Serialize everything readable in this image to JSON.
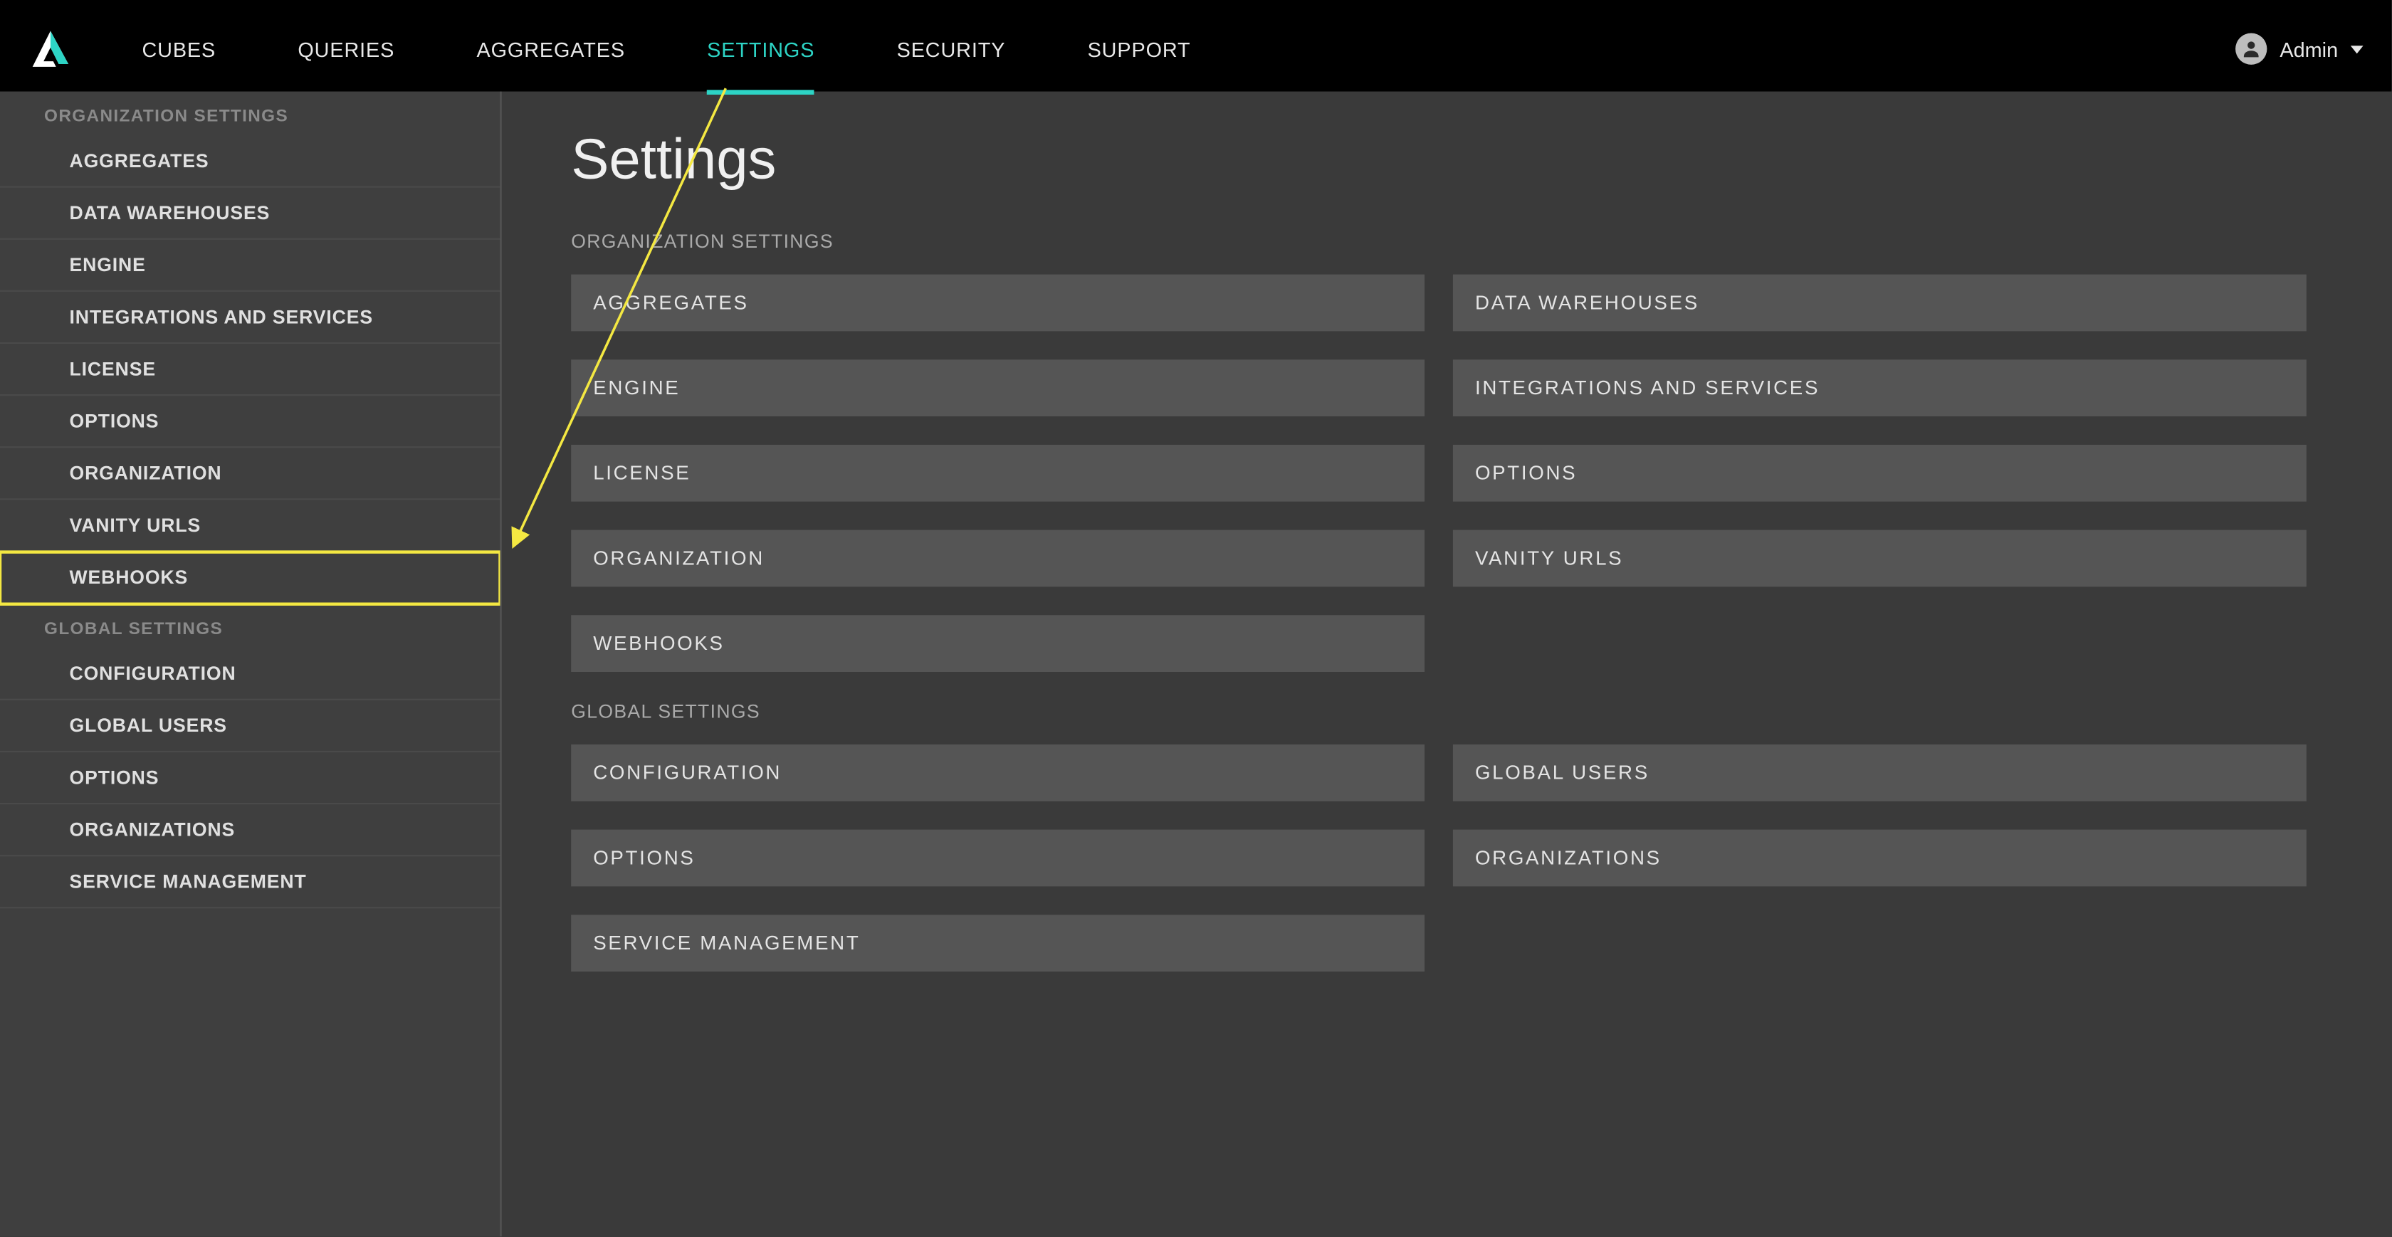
{
  "nav": {
    "items": [
      {
        "label": "CUBES",
        "active": false
      },
      {
        "label": "QUERIES",
        "active": false
      },
      {
        "label": "AGGREGATES",
        "active": false
      },
      {
        "label": "SETTINGS",
        "active": true
      },
      {
        "label": "SECURITY",
        "active": false
      },
      {
        "label": "SUPPORT",
        "active": false
      }
    ]
  },
  "user": {
    "name": "Admin"
  },
  "sidebar": {
    "sections": [
      {
        "title": "ORGANIZATION SETTINGS",
        "items": [
          {
            "label": "AGGREGATES"
          },
          {
            "label": "DATA WAREHOUSES"
          },
          {
            "label": "ENGINE"
          },
          {
            "label": "INTEGRATIONS AND SERVICES"
          },
          {
            "label": "LICENSE"
          },
          {
            "label": "OPTIONS"
          },
          {
            "label": "ORGANIZATION"
          },
          {
            "label": "VANITY URLS"
          },
          {
            "label": "WEBHOOKS",
            "highlighted": true
          }
        ]
      },
      {
        "title": "GLOBAL SETTINGS",
        "items": [
          {
            "label": "CONFIGURATION"
          },
          {
            "label": "GLOBAL USERS"
          },
          {
            "label": "OPTIONS"
          },
          {
            "label": "ORGANIZATIONS"
          },
          {
            "label": "SERVICE MANAGEMENT"
          }
        ]
      }
    ]
  },
  "page": {
    "title": "Settings",
    "sections": [
      {
        "title": "ORGANIZATION SETTINGS",
        "tiles": [
          "AGGREGATES",
          "DATA WAREHOUSES",
          "ENGINE",
          "INTEGRATIONS AND SERVICES",
          "LICENSE",
          "OPTIONS",
          "ORGANIZATION",
          "VANITY URLS",
          "WEBHOOKS"
        ]
      },
      {
        "title": "GLOBAL SETTINGS",
        "tiles": [
          "CONFIGURATION",
          "GLOBAL USERS",
          "OPTIONS",
          "ORGANIZATIONS",
          "SERVICE MANAGEMENT"
        ]
      }
    ]
  },
  "colors": {
    "accent": "#2dd4c5",
    "annotation": "#f4e842"
  }
}
